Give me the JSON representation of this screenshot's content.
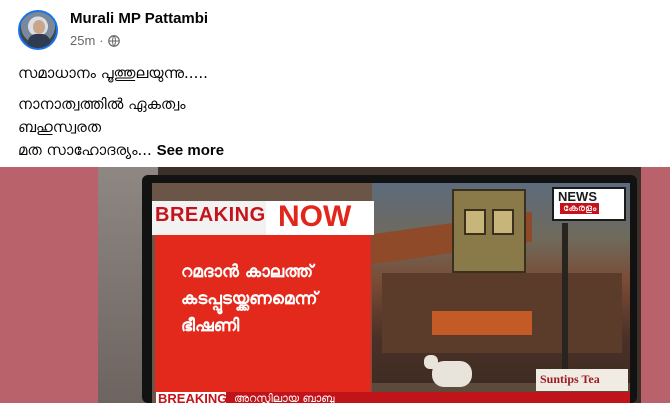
{
  "post": {
    "author": "Murali MP Pattambi",
    "time": "25m",
    "separator": "·",
    "privacy_icon": "globe-icon",
    "lines": [
      "സമാധാനം പൂത്തുലയുന്നു.....",
      "നാനാത്വത്തിൽ ഏകത്വം",
      "ബഹുസ്വരത"
    ],
    "last_line": "മത സാഹോദര്യം...",
    "see_more": "See more"
  },
  "tv": {
    "breaking": "BREAKING",
    "now": "NOW",
    "headline_lines": [
      "റമദാൻ കാലത്ത്",
      "കടപ്പൂടയ്ക്കണമെന്ന്",
      "ഭീഷണി"
    ],
    "bottom_tag": "BREAKING",
    "ticker": "അറസ്റ്റിലായ ബാബു",
    "channel_logo_top": "NEWS",
    "channel_logo_bottom": "കേരളം",
    "sponsor": "Suntips Tea"
  },
  "colors": {
    "media_background": "#b9626b",
    "breaking_red": "#e3291c",
    "link_blue": "#1b74e4"
  }
}
